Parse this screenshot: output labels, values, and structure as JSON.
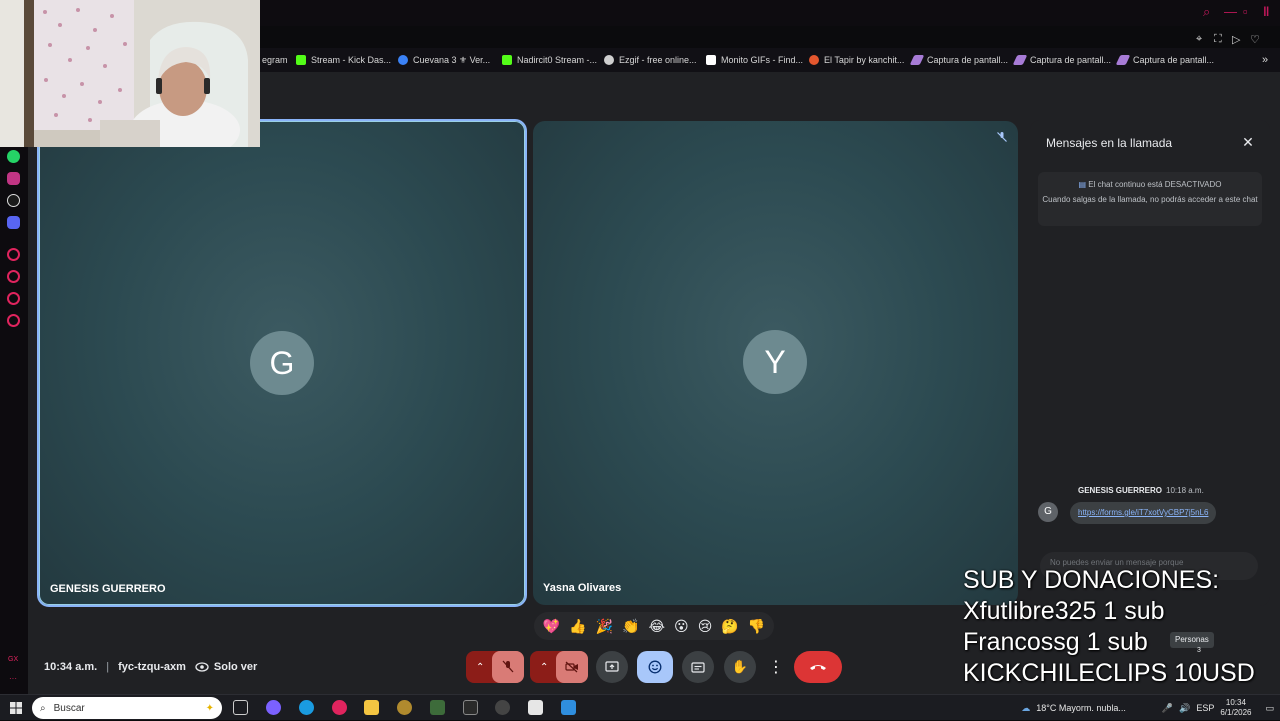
{
  "bookmarks": [
    {
      "label": "egram",
      "icon": "telegram-icon"
    },
    {
      "label": "Stream - Kick Das...",
      "icon": "kick-icon"
    },
    {
      "label": "Cuevana 3 ⚜ Ver...",
      "icon": "cuevana-icon"
    },
    {
      "label": "Nadircit0 Stream -...",
      "icon": "kick-icon"
    },
    {
      "label": "Ezgif - free online...",
      "icon": "ezgif-icon"
    },
    {
      "label": "Monito GIFs - Find...",
      "icon": "page-icon"
    },
    {
      "label": "El Tapir by kanchit...",
      "icon": "tapir-icon"
    },
    {
      "label": "Captura de pantall...",
      "icon": "feather-icon"
    },
    {
      "label": "Captura de pantall...",
      "icon": "feather-icon"
    },
    {
      "label": "Captura de pantall...",
      "icon": "feather-icon"
    }
  ],
  "meeting": {
    "time": "10:34 a.m.",
    "code": "fyc-tzqu-axm",
    "view_mode": "Solo ver",
    "tiles": [
      {
        "name": "GENESIS GUERRERO",
        "initial": "G",
        "active": true
      },
      {
        "name": "Yasna Olivares",
        "initial": "Y",
        "muted": true
      }
    ],
    "reactions": [
      "💖",
      "👍",
      "🎉",
      "👏",
      "😂",
      "😮",
      "😢",
      "🤔",
      "👎"
    ]
  },
  "chat": {
    "title": "Mensajes en la llamada",
    "notice_title": "El chat continuo está DESACTIVADO",
    "notice_body": "Cuando salgas de la llamada, no podrás acceder a este chat",
    "message": {
      "author": "GENESIS GUERRERO",
      "time": "10:18 a.m.",
      "initial": "G",
      "text": "https://forms.gle/iT7xotVyCBP7j5nL6"
    },
    "input_placeholder": "No puedes enviar un mensaje porque"
  },
  "overlay": {
    "lines": [
      "SUB Y DONACIONES:",
      "Xfutlibre325 1 sub",
      "Francossg 1 sub",
      "KICKCHILECLIPS 10USD"
    ]
  },
  "people_tooltip": "Personas",
  "people_count": "3",
  "taskbar": {
    "search_placeholder": "Buscar",
    "weather": "18°C  Mayorm. nubla...",
    "lang": "ESP",
    "time": "10:34",
    "date": "6/1/2026"
  },
  "colors": {
    "tile": "#2c4a51",
    "active_border": "#8ab4f8",
    "hangup": "#dc3535",
    "mute_red": "#8c1d18"
  }
}
